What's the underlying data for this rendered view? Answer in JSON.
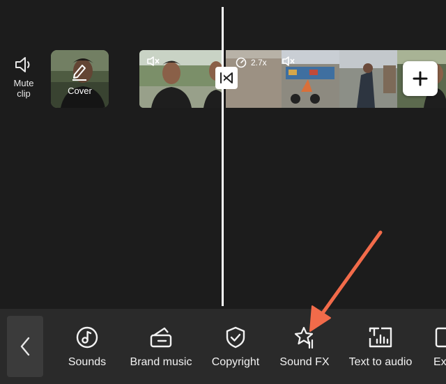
{
  "timeline": {
    "mute_clip_label": "Mute\nclip",
    "cover_label": "Cover",
    "speed_badge": "2.7x"
  },
  "toolbar": {
    "items": [
      {
        "label": "Sounds",
        "icon": "music-note-icon"
      },
      {
        "label": "Brand music",
        "icon": "brand-music-icon"
      },
      {
        "label": "Copyright",
        "icon": "shield-check-icon"
      },
      {
        "label": "Sound FX",
        "icon": "star-sparkle-icon"
      },
      {
        "label": "Text to audio",
        "icon": "text-to-audio-icon"
      },
      {
        "label": "Ex",
        "icon": "partial-icon"
      }
    ]
  },
  "colors": {
    "background": "#1c1c1c",
    "toolbar": "#2a2a2a",
    "annotation_arrow": "#f26b4a"
  }
}
